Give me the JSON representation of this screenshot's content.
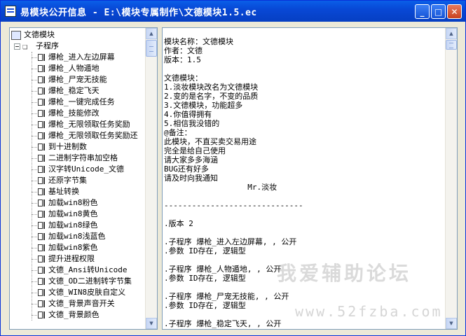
{
  "window": {
    "title": "易模块公开信息 - E:\\模块专属制作\\文德模块1.5.ec",
    "buttons": {
      "minimize": "_",
      "maximize": "□",
      "close": "✕"
    }
  },
  "tree": {
    "root_label": "文德模块",
    "folder_label": "子程序",
    "items": [
      "爆枪_进入左边屏幕",
      "爆枪_人物遁地",
      "爆枪_尸宠无技能",
      "爆枪_稳定飞天",
      "爆枪_一键完成任务",
      "爆枪_技能修改",
      "爆枪_无限领取任务奖励",
      "爆枪_无限领取任务奖励还",
      "到十进制数",
      "二进制字符串加空格",
      "汉字转Unicode_文德",
      "还原字节集",
      "基址转换",
      "加载win8粉色",
      "加载win8黄色",
      "加载win8绿色",
      "加载win8浅蓝色",
      "加载win8紫色",
      "提升进程权限",
      "文德_Ansi转Unicode",
      "文德_OD二进制转字节集",
      "文德_WIN8皮肤自定义",
      "文德_背景声音开关",
      "文德_背景颜色"
    ]
  },
  "content": {
    "text": "模块名称：文德模块\n作者：文德\n版本：1.5\n\n文德模块：\n1.淡妆模块改名为文德模块\n2.变的是名字，不变的品质\n3.文德模块，功能超多\n4.你值得拥有\n5.相信我没错的\n@备注：\n此模块，不直买卖交易用途\n完全是给自己使用\n请大家多多海涵\nBUG还有好多\n请及时向我通知\n                  Mr.淡妆\n\n------------------------------\n\n.版本 2\n\n.子程序 爆枪_进入左边屏幕, , 公开\n.参数 ID存在, 逻辑型\n\n.子程序 爆枪_人物遁地, , 公开\n.参数 ID存在, 逻辑型\n\n.子程序 爆枪_尸宠无技能, , 公开\n.参数 ID存在, 逻辑型\n\n.子程序 爆枪_稳定飞天, , 公开"
  },
  "watermark": {
    "line1": "我爱辅助论坛",
    "line2": "www.52fzba.com"
  }
}
